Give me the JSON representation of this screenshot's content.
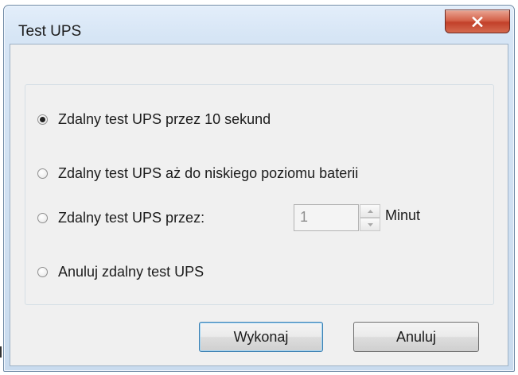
{
  "window": {
    "title": "Test UPS",
    "close_icon": "close-x-icon"
  },
  "options": [
    {
      "label": "Zdalny test UPS przez 10 sekund",
      "checked": true
    },
    {
      "label": "Zdalny test UPS aż do niskiego poziomu baterii",
      "checked": false
    },
    {
      "label": "Zdalny test UPS przez:",
      "checked": false
    },
    {
      "label": "Anuluj zdalny test UPS",
      "checked": false
    }
  ],
  "duration": {
    "value": "1",
    "unit": "Minut",
    "enabled": false
  },
  "buttons": {
    "ok": "Wykonaj",
    "cancel": "Anuluj"
  },
  "colors": {
    "close_button": "#c8462f",
    "default_button_border": "#3c7fb1",
    "dialog_face": "#f0f0f0"
  }
}
